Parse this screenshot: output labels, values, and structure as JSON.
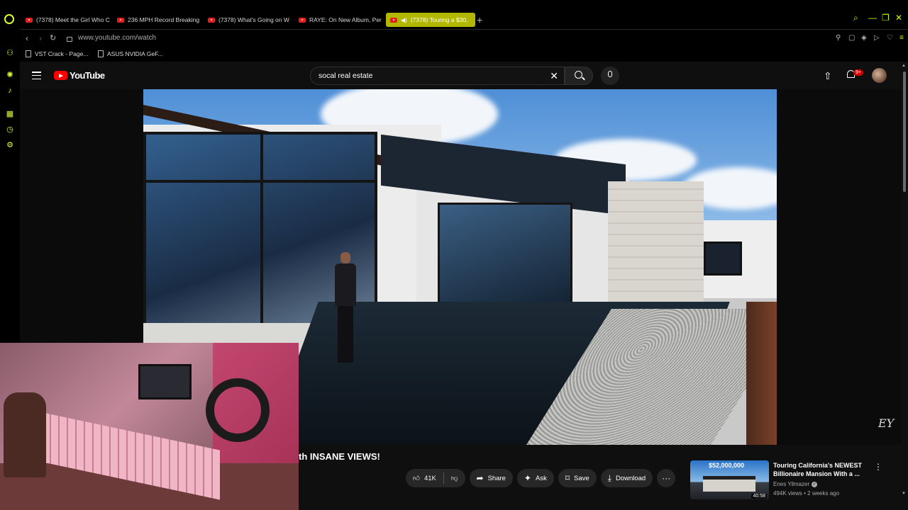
{
  "browser": {
    "tabs": [
      {
        "label": "(7378) Meet the Girl Who C"
      },
      {
        "label": "236 MPH Record Breaking"
      },
      {
        "label": "(7378) What's Going on W"
      },
      {
        "label": "RAYE: On New Album, Per"
      },
      {
        "label": "(7378) Touring a $30,"
      }
    ],
    "new_tab": "+",
    "url": "www.youtube.com/watch",
    "bookmarks": [
      {
        "label": "VST Crack - Page..."
      },
      {
        "label": "ASUS NVIDIA GeF..."
      }
    ],
    "accent": "#d8ff36"
  },
  "youtube": {
    "logo": "YouTube",
    "search_query": "socal real estate",
    "notifications_badge": "9+",
    "brand_color": "#ff0000"
  },
  "video": {
    "title": "th INSANE VIEWS!",
    "watermark": "EY",
    "like_count": "41K",
    "share_label": "Share",
    "ask_label": "Ask",
    "save_label": "Save",
    "download_label": "Download",
    "more_label": "···"
  },
  "recommendation": {
    "title": "Touring California's NEWEST Billionaire Mansion With a ...",
    "channel": "Enes Yilmazer",
    "meta": "494K views • 2 weeks ago",
    "thumb_price": "$52,000,000",
    "duration": "40:58"
  }
}
